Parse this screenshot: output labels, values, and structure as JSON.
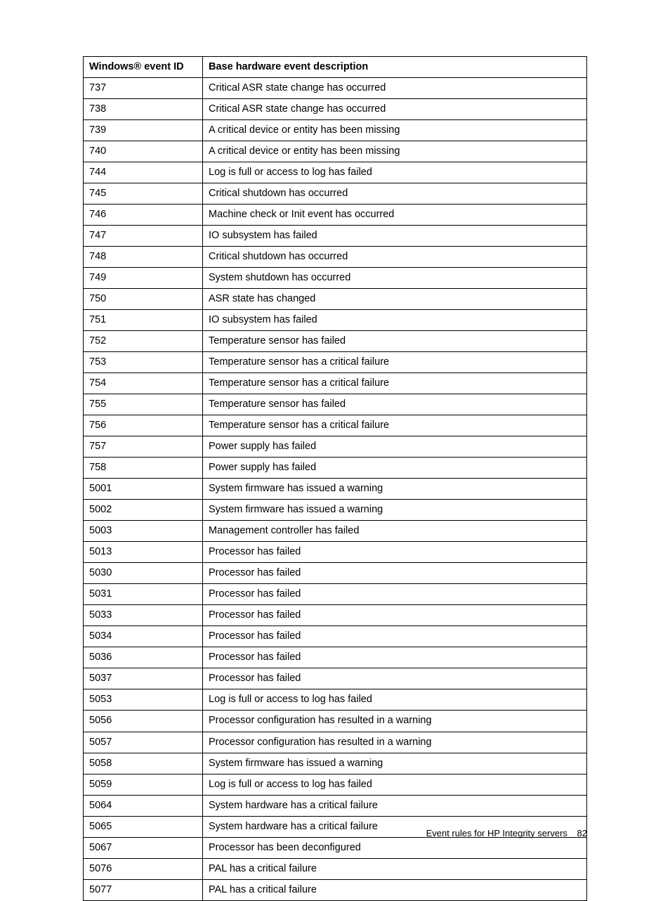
{
  "table": {
    "headers": {
      "id": "Windows® event ID",
      "desc": "Base hardware event description"
    },
    "rows": [
      {
        "id": "737",
        "desc": "Critical ASR state change has occurred"
      },
      {
        "id": "738",
        "desc": "Critical ASR state change has occurred"
      },
      {
        "id": "739",
        "desc": "A critical device or entity has been missing"
      },
      {
        "id": "740",
        "desc": "A critical device or entity has been missing"
      },
      {
        "id": "744",
        "desc": "Log is full or access to log has failed"
      },
      {
        "id": "745",
        "desc": "Critical shutdown has occurred"
      },
      {
        "id": "746",
        "desc": "Machine check or Init event has occurred"
      },
      {
        "id": "747",
        "desc": "IO subsystem has failed"
      },
      {
        "id": "748",
        "desc": "Critical shutdown has occurred"
      },
      {
        "id": "749",
        "desc": "System shutdown has occurred"
      },
      {
        "id": "750",
        "desc": "ASR state has changed"
      },
      {
        "id": "751",
        "desc": "IO subsystem has failed"
      },
      {
        "id": "752",
        "desc": "Temperature sensor has failed"
      },
      {
        "id": "753",
        "desc": "Temperature sensor has a critical failure"
      },
      {
        "id": "754",
        "desc": "Temperature sensor has a critical failure"
      },
      {
        "id": "755",
        "desc": "Temperature sensor has failed"
      },
      {
        "id": "756",
        "desc": "Temperature sensor has a critical failure"
      },
      {
        "id": "757",
        "desc": "Power supply has failed"
      },
      {
        "id": "758",
        "desc": "Power supply has failed"
      },
      {
        "id": "5001",
        "desc": "System firmware has issued a warning"
      },
      {
        "id": "5002",
        "desc": "System firmware has issued a warning"
      },
      {
        "id": "5003",
        "desc": "Management controller has failed"
      },
      {
        "id": "5013",
        "desc": "Processor has failed"
      },
      {
        "id": "5030",
        "desc": "Processor has failed"
      },
      {
        "id": "5031",
        "desc": "Processor has failed"
      },
      {
        "id": "5033",
        "desc": "Processor has failed"
      },
      {
        "id": "5034",
        "desc": "Processor has failed"
      },
      {
        "id": "5036",
        "desc": "Processor has failed"
      },
      {
        "id": "5037",
        "desc": "Processor has failed"
      },
      {
        "id": "5053",
        "desc": "Log is full or access to log has failed"
      },
      {
        "id": "5056",
        "desc": "Processor configuration has resulted in a warning"
      },
      {
        "id": "5057",
        "desc": "Processor configuration has resulted in a warning"
      },
      {
        "id": "5058",
        "desc": "System firmware has issued a warning"
      },
      {
        "id": "5059",
        "desc": "Log is full or access to log has failed"
      },
      {
        "id": "5064",
        "desc": "System hardware has a critical failure"
      },
      {
        "id": "5065",
        "desc": "System hardware has a critical failure"
      },
      {
        "id": "5067",
        "desc": "Processor has been deconfigured"
      },
      {
        "id": "5076",
        "desc": "PAL has a critical failure"
      },
      {
        "id": "5077",
        "desc": "PAL has a critical failure"
      }
    ]
  },
  "footer": {
    "text": "Event rules for HP Integrity servers",
    "page": "82"
  }
}
